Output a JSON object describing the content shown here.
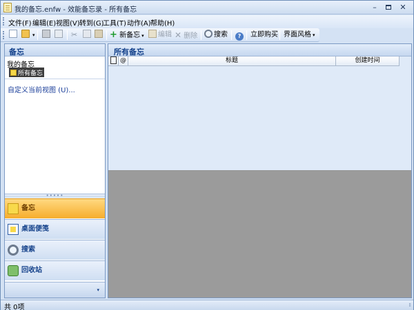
{
  "window": {
    "title": "我的备忘.enfw - 效能备忘录 - 所有备忘",
    "controls": {
      "minimize": "–",
      "maximize": "",
      "close": "✕"
    }
  },
  "menu": [
    "文件(F)",
    "编辑(E)",
    "视图(V)",
    "转到(G)",
    "工具(T)",
    "动作(A)",
    "帮助(H)"
  ],
  "toolbar": {
    "new_memo": "新备忘",
    "edit": "编辑",
    "delete": "删除",
    "search": "搜索",
    "buy": "立即购买",
    "theme": "界面风格",
    "dropdown_arrow": "▾",
    "plus": "+",
    "cut": "✂",
    "x": "✕",
    "help": "?"
  },
  "left_pane": {
    "header": "备忘",
    "tree_root": "我的备忘",
    "tree_node": "所有备忘",
    "customize_link": "自定义当前视图 (U)...",
    "splitter": "•••••",
    "nav_items": [
      {
        "label": "备忘",
        "icon": "note-icon",
        "active": true
      },
      {
        "label": "桌面便笺",
        "icon": "desktop-note-icon",
        "active": false
      },
      {
        "label": "搜索",
        "icon": "search-icon",
        "active": false
      },
      {
        "label": "回收站",
        "icon": "recycle-bin-icon",
        "active": false
      }
    ],
    "more": "▾"
  },
  "right_pane": {
    "header": "所有备忘",
    "columns": [
      "",
      "@",
      "标题",
      "创建时间"
    ],
    "scroll_left": "◀",
    "scroll_right": "▶",
    "rows": []
  },
  "status": {
    "text": "共 0项",
    "grip": "⁞⁞"
  },
  "colors": {
    "accent": "#15428b",
    "active_nav": "#f6ad2c",
    "chrome": "#d4e2f4"
  }
}
